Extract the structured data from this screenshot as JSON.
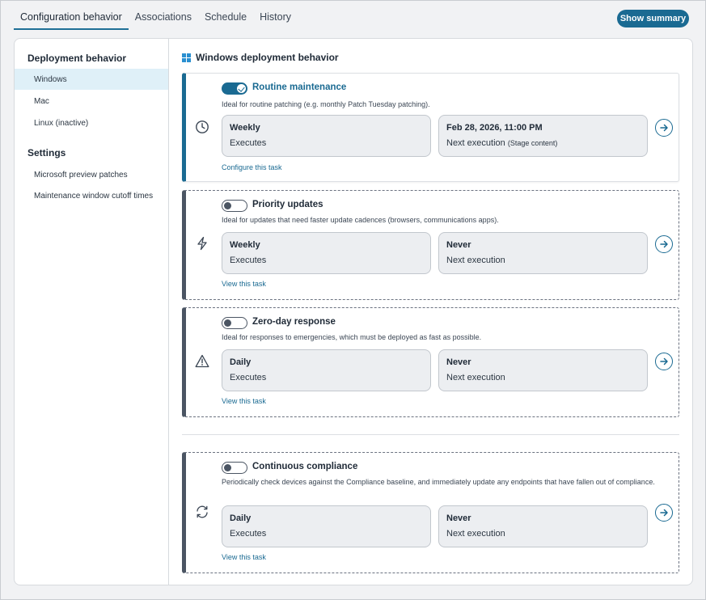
{
  "tabs": [
    {
      "label": "Configuration behavior",
      "active": true
    },
    {
      "label": "Associations",
      "active": false
    },
    {
      "label": "Schedule",
      "active": false
    },
    {
      "label": "History",
      "active": false
    }
  ],
  "show_summary_label": "Show summary",
  "sidebar": {
    "deployment_heading": "Deployment behavior",
    "deployment_items": [
      {
        "label": "Windows",
        "active": true
      },
      {
        "label": "Mac",
        "active": false
      },
      {
        "label": "Linux (inactive)",
        "active": false
      }
    ],
    "settings_heading": "Settings",
    "settings_items": [
      {
        "label": "Microsoft preview patches"
      },
      {
        "label": "Maintenance window cutoff times"
      }
    ]
  },
  "content": {
    "title": "Windows deployment behavior",
    "title_icon": "windows-logo-icon",
    "cards": [
      {
        "title": "Routine maintenance",
        "enabled": true,
        "icon": "clock-icon",
        "description": "Ideal for routine patching (e.g. monthly Patch Tuesday patching).",
        "frequency": "Weekly",
        "frequency_caption": "Executes",
        "next_value": "Feb 28, 2026, 11:00 PM",
        "next_caption": "Next execution",
        "next_note": "(Stage content)",
        "link": "Configure this task"
      },
      {
        "title": "Priority updates",
        "enabled": false,
        "icon": "lightning-icon",
        "description": "Ideal for updates that need faster update cadences (browsers, communications apps).",
        "frequency": "Weekly",
        "frequency_caption": "Executes",
        "next_value": "Never",
        "next_caption": "Next execution",
        "link": "View this task"
      },
      {
        "title": "Zero-day response",
        "enabled": false,
        "icon": "warning-triangle-icon",
        "description": "Ideal for responses to emergencies, which must be deployed as fast as possible.",
        "frequency": "Daily",
        "frequency_caption": "Executes",
        "next_value": "Never",
        "next_caption": "Next execution",
        "link": "View this task"
      },
      {
        "title": "Continuous compliance",
        "enabled": false,
        "icon": "refresh-icon",
        "description": "Periodically check devices against the Compliance baseline, and immediately update any endpoints that have fallen out of compliance.",
        "frequency": "Daily",
        "frequency_caption": "Executes",
        "next_value": "Never",
        "next_caption": "Next execution",
        "link": "View this task"
      }
    ]
  },
  "colors": {
    "accent": "#1a6a92",
    "active_sidebar_bg": "#dff0f8",
    "disabled_border": "#4b5563"
  }
}
